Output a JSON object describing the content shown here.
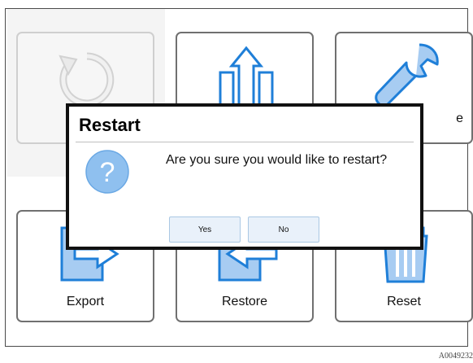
{
  "tiles": [
    {
      "id": "restart",
      "label": "",
      "disabled": true
    },
    {
      "id": "reimport",
      "label": ""
    },
    {
      "id": "service",
      "label": "e"
    },
    {
      "id": "export",
      "label": "Export"
    },
    {
      "id": "restore",
      "label": "Restore"
    },
    {
      "id": "reset",
      "label": "Reset"
    }
  ],
  "dialog": {
    "title": "Restart",
    "message": "Are you sure you would like to restart?",
    "yes_label": "Yes",
    "no_label": "No",
    "icon": "question-icon"
  },
  "figure_id": "A0049232",
  "colors": {
    "icon_fill": "#a7ccf2",
    "icon_stroke": "#1f7fd8",
    "question_fill": "#8fc0ef"
  }
}
